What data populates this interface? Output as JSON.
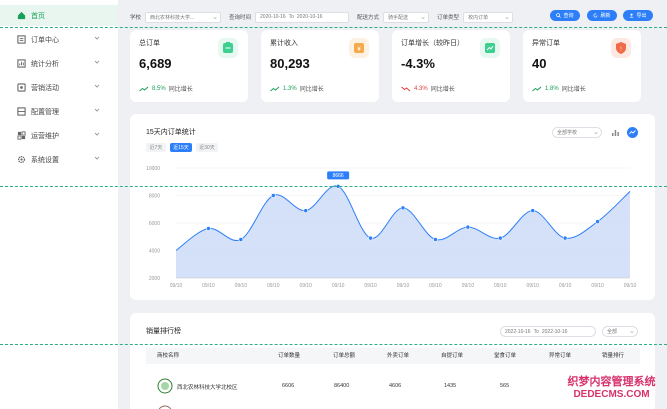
{
  "sidebar": {
    "items": [
      {
        "label": "首页",
        "active": true,
        "icon": "home-icon"
      },
      {
        "label": "订单中心",
        "icon": "order-icon"
      },
      {
        "label": "统计分析",
        "icon": "stats-icon"
      },
      {
        "label": "营销活动",
        "icon": "marketing-icon"
      },
      {
        "label": "配置管理",
        "icon": "config-icon"
      },
      {
        "label": "运营维护",
        "icon": "ops-icon"
      },
      {
        "label": "系统设置",
        "icon": "settings-icon"
      }
    ]
  },
  "filters": {
    "school_label": "学校",
    "school_value": "西北农林科技大学...",
    "time_label": "查询时间",
    "time_start": "2020-10-16",
    "time_sep": "To",
    "time_end": "2020-10-16",
    "delivery_label": "配送方式",
    "delivery_value": "骑手配送",
    "order_type_label": "订单类型",
    "order_type_value": "校内订单"
  },
  "actions": {
    "query": "查询",
    "refresh": "刷新",
    "export": "导出"
  },
  "cards": [
    {
      "title": "总订单",
      "value": "6,689",
      "pct": "8.5%",
      "suffix": "同比增长",
      "dir": "up",
      "color": "#3ccf8f",
      "bg": "#e6f8ef"
    },
    {
      "title": "累计收入",
      "value": "80,293",
      "pct": "1.3%",
      "suffix": "同比增长",
      "dir": "up",
      "color": "#f5a94b",
      "bg": "#fdf1e2"
    },
    {
      "title": "订单增长（较昨日）",
      "value": "-4.3%",
      "pct": "4.3%",
      "suffix": "同比增长",
      "dir": "down",
      "color": "#3ccf8f",
      "bg": "#e6f8ef"
    },
    {
      "title": "异常订单",
      "value": "40",
      "pct": "1.8%",
      "suffix": "同比增长",
      "dir": "up",
      "color": "#f06a4a",
      "bg": "#fde8e2"
    }
  ],
  "trend_panel": {
    "title": "15天内订单统计",
    "tabs": [
      "近7天",
      "近15天",
      "近30天"
    ],
    "active_tab": 1,
    "school_select": "全部学校"
  },
  "chart_data": {
    "type": "area",
    "x": [
      "09/10",
      "09/10",
      "09/10",
      "09/10",
      "09/10",
      "09/10",
      "09/10",
      "09/10",
      "09/10",
      "09/10",
      "09/10",
      "09/10",
      "09/10",
      "09/10",
      "09/10"
    ],
    "values": [
      4000,
      5600,
      4800,
      8000,
      6900,
      8666,
      4900,
      7100,
      4800,
      5700,
      4900,
      6900,
      4900,
      6100,
      8300
    ],
    "highlight": {
      "index": 5,
      "label": "8666"
    },
    "yticks": [
      "10000",
      "8000",
      "6000",
      "4000",
      "2000"
    ],
    "ylim": [
      2000,
      10000
    ],
    "line_color": "#2d7ff9",
    "fill_color": "#c9d9f7"
  },
  "ranking": {
    "title": "销量排行榜",
    "date_start": "2022-10-16",
    "date_sep": "To",
    "date_end": "2022-10-16",
    "filter": "全部",
    "columns": [
      "商校名称",
      "订单数量",
      "订单总额",
      "外卖订单",
      "自提订单",
      "堂食订单",
      "异常订单",
      "销量排行"
    ],
    "rows": [
      {
        "name": "西北农林科技大学北校区",
        "orders": "6606",
        "total": "86400",
        "takeout": "4606",
        "pickup": "1435",
        "dinein": "565",
        "abnormal": "",
        "rank": ""
      }
    ]
  },
  "watermark": {
    "line1": "织梦内容管理系统",
    "line2": "DEDECMS.COM"
  }
}
